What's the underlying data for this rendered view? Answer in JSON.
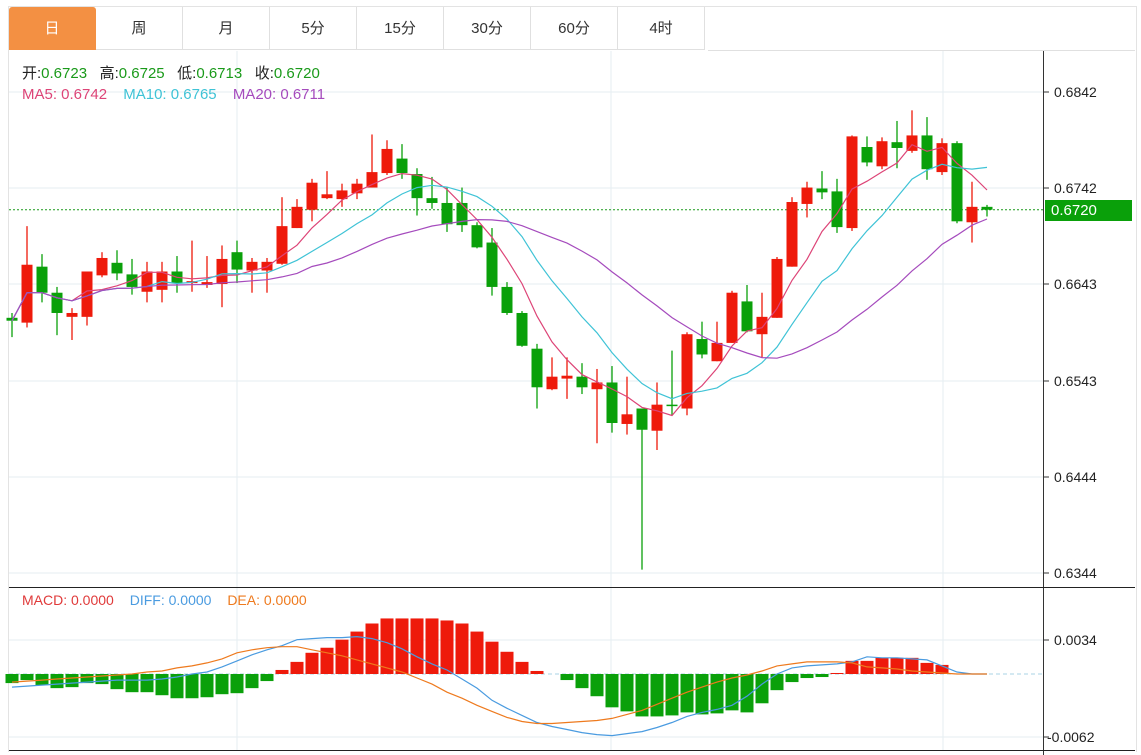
{
  "tabs": [
    "日",
    "周",
    "月",
    "5分",
    "15分",
    "30分",
    "60分",
    "4时"
  ],
  "active_tab": 0,
  "ohlc_legend": {
    "open_label": "开:",
    "open": "0.6723",
    "high_label": "高:",
    "high": "0.6725",
    "low_label": "低:",
    "low": "0.6713",
    "close_label": "收:",
    "close": "0.6720"
  },
  "ma_legend": {
    "ma5": "MA5: 0.6742",
    "ma10": "MA10: 0.6765",
    "ma20": "MA20: 0.6711"
  },
  "macd_legend": {
    "macd": "MACD: 0.0000",
    "diff": "DIFF: 0.0000",
    "dea": "DEA: 0.0000"
  },
  "current_price": "0.6720",
  "colors": {
    "up": "#ee1a0b",
    "down": "#0aa00a",
    "ma5": "#dd4477",
    "ma10": "#3fc3d6",
    "ma20": "#a54bbd",
    "diff": "#4a9be0",
    "dea": "#ee7a1e",
    "tab_active": "#f39043"
  },
  "chart_data": [
    {
      "type": "candlestick",
      "title": "",
      "y_ticks": [
        "0.6842",
        "0.6742",
        "0.6643",
        "0.6543",
        "0.6444",
        "0.6344"
      ],
      "ylim": [
        0.6344,
        0.6842
      ],
      "ma_periods": [
        5,
        10,
        20
      ],
      "candles": [
        [
          0.6608,
          0.6613,
          0.6588,
          0.6605
        ],
        [
          0.6603,
          0.6703,
          0.6598,
          0.6663
        ],
        [
          0.6661,
          0.6674,
          0.6624,
          0.6634
        ],
        [
          0.6634,
          0.664,
          0.659,
          0.6613
        ],
        [
          0.6609,
          0.6618,
          0.6585,
          0.6613
        ],
        [
          0.6609,
          0.6656,
          0.66,
          0.6656
        ],
        [
          0.6652,
          0.6676,
          0.665,
          0.667
        ],
        [
          0.6665,
          0.6678,
          0.6647,
          0.6654
        ],
        [
          0.6653,
          0.6669,
          0.6632,
          0.664
        ],
        [
          0.6635,
          0.6666,
          0.6624,
          0.6656
        ],
        [
          0.6637,
          0.6666,
          0.6624,
          0.6656
        ],
        [
          0.6656,
          0.6672,
          0.6634,
          0.6644
        ],
        [
          0.6644,
          0.6688,
          0.6635,
          0.6646
        ],
        [
          0.6642,
          0.6672,
          0.6639,
          0.6645
        ],
        [
          0.6643,
          0.6683,
          0.6619,
          0.6669
        ],
        [
          0.6676,
          0.6688,
          0.6644,
          0.6658
        ],
        [
          0.6657,
          0.667,
          0.6634,
          0.6666
        ],
        [
          0.6657,
          0.667,
          0.6634,
          0.6666
        ],
        [
          0.6664,
          0.6733,
          0.6663,
          0.6703
        ],
        [
          0.6701,
          0.6731,
          0.6701,
          0.6723
        ],
        [
          0.672,
          0.6752,
          0.6708,
          0.6748
        ],
        [
          0.6732,
          0.676,
          0.6731,
          0.6736
        ],
        [
          0.6731,
          0.6747,
          0.6723,
          0.674
        ],
        [
          0.6737,
          0.6752,
          0.6731,
          0.6747
        ],
        [
          0.6743,
          0.6798,
          0.6743,
          0.6759
        ],
        [
          0.6758,
          0.6792,
          0.6756,
          0.6783
        ],
        [
          0.6773,
          0.6788,
          0.6752,
          0.6758
        ],
        [
          0.6757,
          0.6763,
          0.6714,
          0.6732
        ],
        [
          0.6732,
          0.6754,
          0.6721,
          0.6727
        ],
        [
          0.6727,
          0.6743,
          0.6697,
          0.6705
        ],
        [
          0.6727,
          0.6743,
          0.6697,
          0.6704
        ],
        [
          0.6704,
          0.6707,
          0.668,
          0.6681
        ],
        [
          0.6686,
          0.6701,
          0.6631,
          0.664
        ],
        [
          0.664,
          0.6645,
          0.6611,
          0.6613
        ],
        [
          0.6613,
          0.6615,
          0.6578,
          0.6579
        ],
        [
          0.6576,
          0.6581,
          0.6514,
          0.6536
        ],
        [
          0.6534,
          0.6567,
          0.6533,
          0.6547
        ],
        [
          0.6545,
          0.6567,
          0.6524,
          0.6548
        ],
        [
          0.6547,
          0.6561,
          0.6529,
          0.6536
        ],
        [
          0.6534,
          0.6555,
          0.6478,
          0.6541
        ],
        [
          0.6541,
          0.6558,
          0.6489,
          0.6499
        ],
        [
          0.6498,
          0.6547,
          0.6487,
          0.6508
        ],
        [
          0.6514,
          0.6514,
          0.6347,
          0.6492
        ],
        [
          0.6491,
          0.6541,
          0.6471,
          0.6518
        ],
        [
          0.6518,
          0.6574,
          0.6507,
          0.6517
        ],
        [
          0.6514,
          0.6593,
          0.6507,
          0.6591
        ],
        [
          0.6586,
          0.6604,
          0.6566,
          0.657
        ],
        [
          0.6563,
          0.6604,
          0.6563,
          0.6582
        ],
        [
          0.6582,
          0.6636,
          0.6582,
          0.6634
        ],
        [
          0.6625,
          0.6642,
          0.6593,
          0.6594
        ],
        [
          0.6591,
          0.6634,
          0.6567,
          0.6609
        ],
        [
          0.6608,
          0.6671,
          0.6608,
          0.6669
        ],
        [
          0.6661,
          0.6733,
          0.6661,
          0.6728
        ],
        [
          0.6726,
          0.6749,
          0.6712,
          0.6743
        ],
        [
          0.6742,
          0.676,
          0.6731,
          0.6738
        ],
        [
          0.6739,
          0.6752,
          0.6696,
          0.6702
        ],
        [
          0.6701,
          0.6797,
          0.6698,
          0.6796
        ],
        [
          0.6785,
          0.6796,
          0.6765,
          0.6769
        ],
        [
          0.6765,
          0.6795,
          0.6762,
          0.6791
        ],
        [
          0.679,
          0.6812,
          0.6763,
          0.6784
        ],
        [
          0.6781,
          0.6823,
          0.6779,
          0.6797
        ],
        [
          0.6797,
          0.6816,
          0.6751,
          0.6762
        ],
        [
          0.6759,
          0.6794,
          0.6756,
          0.6789
        ],
        [
          0.6789,
          0.6791,
          0.6706,
          0.6708
        ],
        [
          0.6707,
          0.6749,
          0.6686,
          0.6723
        ],
        [
          0.6723,
          0.6725,
          0.6713,
          0.672
        ]
      ]
    },
    {
      "type": "bar",
      "title": "MACD",
      "y_ticks": [
        "0.0034",
        "-0.0062"
      ],
      "ylim": [
        -0.0062,
        0.0034
      ],
      "macd": [
        -0.0009,
        -0.0006,
        -0.0011,
        -0.0014,
        -0.0013,
        -0.0009,
        -0.001,
        -0.0015,
        -0.0018,
        -0.0018,
        -0.0021,
        -0.0024,
        -0.0024,
        -0.0023,
        -0.002,
        -0.0019,
        -0.0014,
        -0.0007,
        0.0004,
        0.0012,
        0.0021,
        0.0026,
        0.0034,
        0.0042,
        0.005,
        0.0055,
        0.0055,
        0.0055,
        0.0055,
        0.0053,
        0.005,
        0.0042,
        0.0032,
        0.0022,
        0.0012,
        0.0003,
        0.0,
        -0.0006,
        -0.0014,
        -0.0022,
        -0.0033,
        -0.0037,
        -0.0042,
        -0.0042,
        -0.0041,
        -0.0038,
        -0.004,
        -0.0039,
        -0.0036,
        -0.0038,
        -0.0029,
        -0.0016,
        -0.0008,
        -0.0004,
        -0.0003,
        0.0001,
        0.0013,
        0.0013,
        0.0016,
        0.0016,
        0.0016,
        0.0011,
        0.0009,
        0.0,
        0.0,
        0.0
      ],
      "diff": [
        -0.0013,
        -0.0012,
        -0.0011,
        -0.001,
        -0.0009,
        -0.0008,
        -0.0007,
        -0.0006,
        -0.0006,
        -0.0006,
        -0.0005,
        -0.0003,
        0.0,
        0.0002,
        0.0007,
        0.0013,
        0.0019,
        0.0024,
        0.0028,
        0.0034,
        0.0035,
        0.0036,
        0.0036,
        0.0037,
        0.0035,
        0.0031,
        0.0025,
        0.0017,
        0.001,
        0.0004,
        -0.0005,
        -0.0014,
        -0.0026,
        -0.0034,
        -0.0041,
        -0.0048,
        -0.0052,
        -0.0055,
        -0.0058,
        -0.006,
        -0.0061,
        -0.0059,
        -0.0057,
        -0.0053,
        -0.0048,
        -0.0042,
        -0.0038,
        -0.0035,
        -0.0031,
        -0.0022,
        -0.001,
        0.0,
        0.0006,
        0.0008,
        0.0009,
        0.001,
        0.0012,
        0.0017,
        0.0016,
        0.0016,
        0.0015,
        0.0014,
        0.0008,
        0.0002,
        0.0,
        0.0
      ],
      "dea": [
        -0.0008,
        -0.0007,
        -0.0006,
        -0.0005,
        -0.0004,
        -0.0003,
        -0.0002,
        -0.0001,
        0.0,
        0.0002,
        0.0003,
        0.0006,
        0.0008,
        0.0011,
        0.0015,
        0.0021,
        0.0024,
        0.0026,
        0.0027,
        0.0027,
        0.0024,
        0.0021,
        0.0018,
        0.0014,
        0.001,
        0.0006,
        0.0002,
        -0.0004,
        -0.001,
        -0.0018,
        -0.0024,
        -0.0031,
        -0.0037,
        -0.0043,
        -0.0047,
        -0.0049,
        -0.0049,
        -0.0048,
        -0.0047,
        -0.0046,
        -0.0044,
        -0.004,
        -0.0036,
        -0.003,
        -0.0024,
        -0.0018,
        -0.0013,
        -0.0008,
        -0.0004,
        -0.0001,
        0.0003,
        0.0008,
        0.001,
        0.0012,
        0.0012,
        0.0012,
        0.0011,
        0.0007,
        0.0006,
        0.0005,
        0.0003,
        0.0002,
        0.0001,
        0.0,
        0.0,
        0.0
      ]
    }
  ]
}
